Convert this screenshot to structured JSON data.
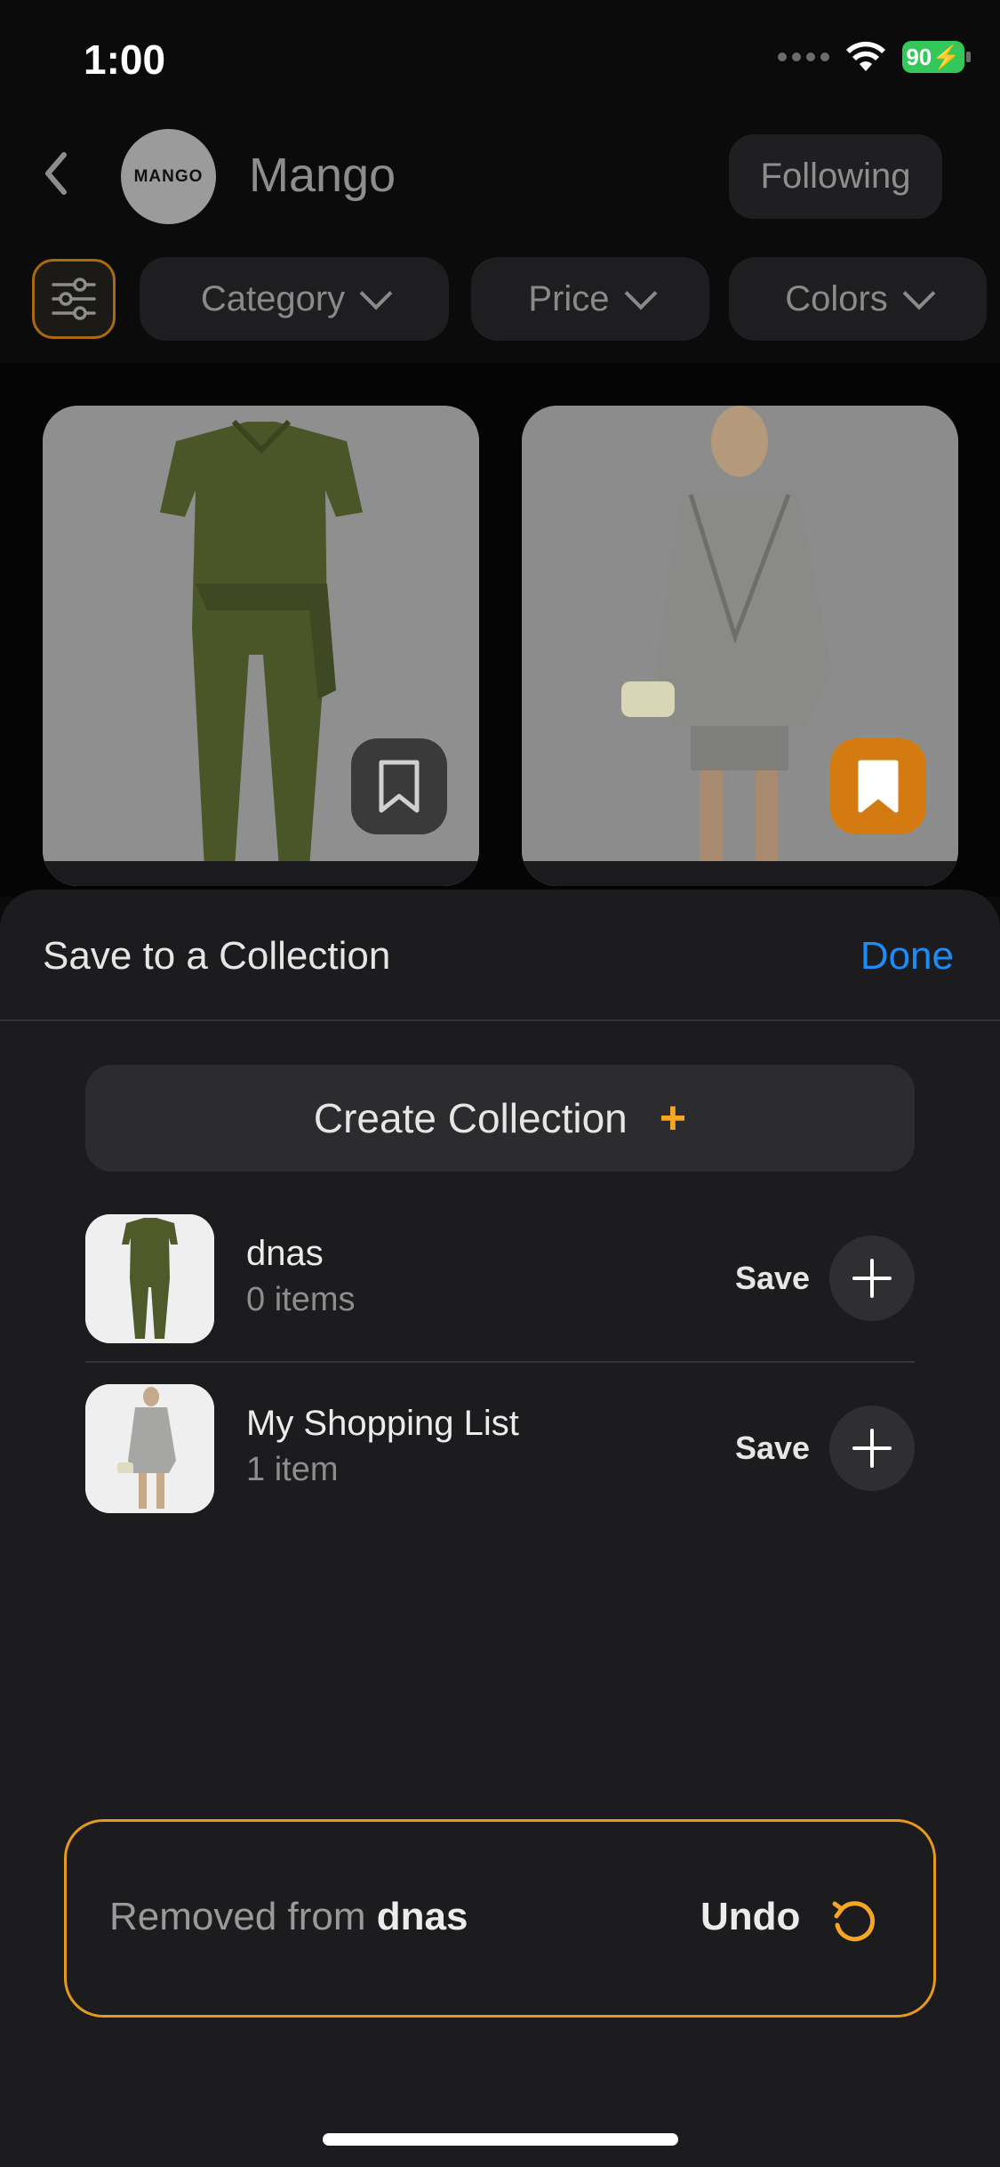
{
  "status_bar": {
    "time": "1:00",
    "battery": "90"
  },
  "header": {
    "brand_logo_text": "MANGO",
    "title": "Mango",
    "follow_label": "Following"
  },
  "filters": {
    "category": "Category",
    "price": "Price",
    "colors": "Colors"
  },
  "products": [
    {
      "image": "olive-green-jumpsuit",
      "saved": false
    },
    {
      "image": "grey-plaid-blazer-outfit",
      "saved": true
    }
  ],
  "sheet": {
    "title": "Save to a Collection",
    "done_label": "Done",
    "create_label": "Create Collection",
    "create_symbol": "+",
    "collections": [
      {
        "name": "dnas",
        "count": "0 items",
        "save_label": "Save"
      },
      {
        "name": "My Shopping List",
        "count": "1 item",
        "save_label": "Save"
      }
    ]
  },
  "toast": {
    "prefix": "Removed from ",
    "collection": "dnas",
    "undo_label": "Undo"
  },
  "colors": {
    "accent": "#f5a623",
    "link": "#1e8cf5",
    "toast_border": "#e39a1d"
  }
}
